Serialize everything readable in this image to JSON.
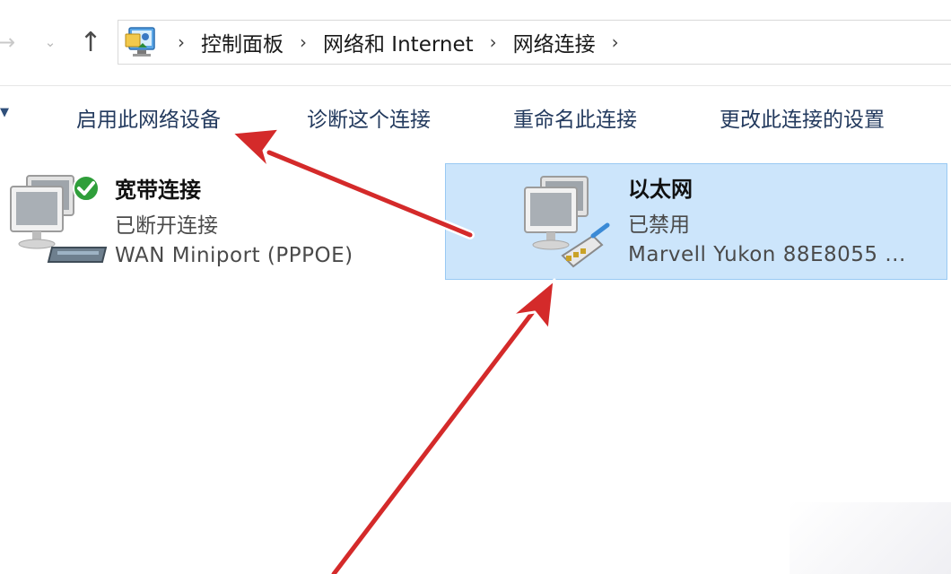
{
  "colors": {
    "selection_fill": "#cce5fb",
    "selection_border": "#99c9f3",
    "command_text": "#233a5e",
    "annotation_arrow": "#d42a2a",
    "ok_badge": "#2f9e3a"
  },
  "navigation": {
    "back_icon": "arrow-left-icon",
    "history_icon": "chevron-down-icon",
    "up_icon": "arrow-up-icon",
    "breadcrumb": [
      "控制面板",
      "网络和 Internet",
      "网络连接"
    ],
    "trailing_separator": "›"
  },
  "toolbar": {
    "overflow_icon": "chevron-icon",
    "enable_device": "启用此网络设备",
    "diagnose": "诊断这个连接",
    "rename": "重命名此连接",
    "change_settings": "更改此连接的设置"
  },
  "connections": [
    {
      "name": "宽带连接",
      "status": "已断开连接",
      "device": "WAN Miniport (PPPOE)",
      "icon": "broadband-connection-icon",
      "selected": false
    },
    {
      "name": "以太网",
      "status": "已禁用",
      "device": "Marvell Yukon 88E8055 ...",
      "icon": "ethernet-disabled-icon",
      "selected": true
    }
  ]
}
